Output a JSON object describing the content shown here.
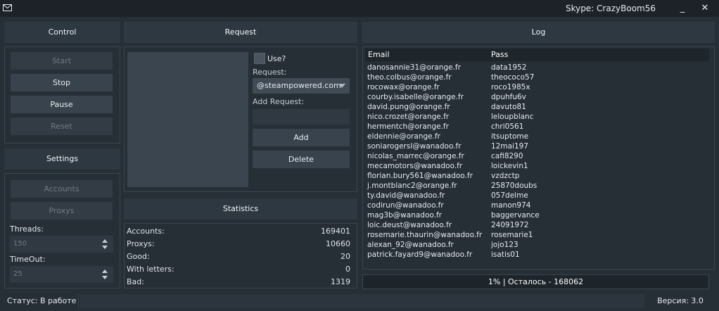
{
  "window": {
    "title": "Skype: CrazyBoom56",
    "minimize_glyph": "_",
    "close_glyph": "✕"
  },
  "control": {
    "header": "Control",
    "start": "Start",
    "stop": "Stop",
    "pause": "Pause",
    "reset": "Reset"
  },
  "settings": {
    "header": "Settings",
    "accounts": "Accounts",
    "proxys": "Proxys",
    "threads_label": "Threads:",
    "threads_value": "150",
    "timeout_label": "TimeOut:",
    "timeout_value": "25"
  },
  "request": {
    "header": "Request",
    "use_label": "Use?",
    "request_label": "Request:",
    "request_selected": "@steampowered.com",
    "add_request_label": "Add Request:",
    "add": "Add",
    "delete": "Delete"
  },
  "statistics": {
    "header": "Statistics",
    "rows": [
      {
        "label": "Accounts:",
        "value": "169401"
      },
      {
        "label": "Proxys:",
        "value": "10660"
      },
      {
        "label": "Good:",
        "value": "20"
      },
      {
        "label": "With letters:",
        "value": "0"
      },
      {
        "label": "Bad:",
        "value": "1319"
      }
    ]
  },
  "log": {
    "header": "Log",
    "columns": {
      "email": "Email",
      "pass": "Pass"
    },
    "rows": [
      {
        "email": "danosannie31@orange.fr",
        "pass": "data1952"
      },
      {
        "email": "theo.colbus@orange.fr",
        "pass": "theococo57"
      },
      {
        "email": "rocowax@orange.fr",
        "pass": "roco1985x"
      },
      {
        "email": "courby.isabelle@orange.fr",
        "pass": "dpuhfu6v"
      },
      {
        "email": "david.pung@orange.fr",
        "pass": "davuto81"
      },
      {
        "email": "nico.crozet@orange.fr",
        "pass": "leloupblanc"
      },
      {
        "email": "hermentch@orange.fr",
        "pass": "chri0561"
      },
      {
        "email": "eldennie@orange.fr",
        "pass": "itsuptome"
      },
      {
        "email": "soniarogersl@wanadoo.fr",
        "pass": "12mai197"
      },
      {
        "email": "nicolas_marrec@orange.fr",
        "pass": "cafi8290"
      },
      {
        "email": "mecamotors@wanadoo.fr",
        "pass": "loickevin1"
      },
      {
        "email": "florian.bury561@wanadoo.fr",
        "pass": "vzdzctp"
      },
      {
        "email": "j.montblanc2@orange.fr",
        "pass": "25870doubs"
      },
      {
        "email": "ty.david@wanadoo.fr",
        "pass": "057delme"
      },
      {
        "email": "codirun@wanadoo.fr",
        "pass": "manon974"
      },
      {
        "email": "mag3b@wanadoo.fr",
        "pass": "baggervance"
      },
      {
        "email": "loic.deust@wanadoo.fr",
        "pass": "24091972"
      },
      {
        "email": "rosemarie.thaurin@wanadoo.fr",
        "pass": "rosemarie1"
      },
      {
        "email": "alexan_92@wanadoo.fr",
        "pass": "jojo123"
      },
      {
        "email": "patrick.fayard9@wanadoo.fr",
        "pass": "isatis01"
      }
    ]
  },
  "progress": {
    "text": "1% | Осталось - 168062",
    "percent": 1
  },
  "status": {
    "left": "Статус: В работе",
    "right": "Версия: 3.0"
  }
}
